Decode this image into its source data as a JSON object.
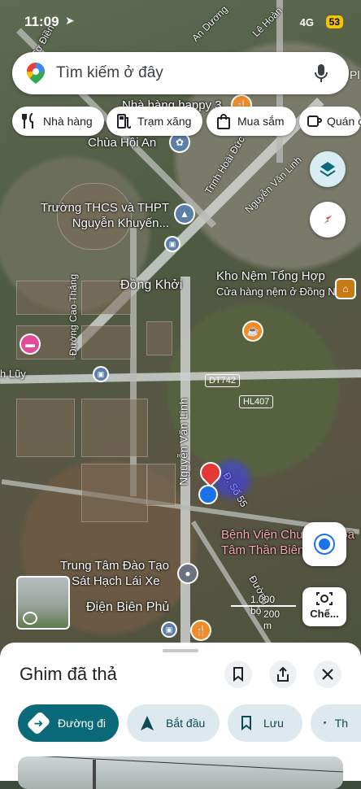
{
  "status_bar": {
    "time": "11:09",
    "network": "4G",
    "battery": "53"
  },
  "search": {
    "placeholder": "Tìm kiếm ở đây",
    "right_partial": "Pl"
  },
  "chips": [
    {
      "label": "Nhà hàng",
      "icon": "fork-knife-icon"
    },
    {
      "label": "Trạm xăng",
      "icon": "gas-station-icon"
    },
    {
      "label": "Mua sắm",
      "icon": "shopping-bag-icon"
    },
    {
      "label": "Quán cà",
      "icon": "coffee-cup-icon"
    }
  ],
  "map": {
    "places": {
      "school": "Trường THCS và THPT Nguyễn Khuyến...",
      "pagoda": "Chùa Hội An",
      "restaurant": "Nhà hàng happy 3",
      "store_name": "Kho Nệm Tổng Hợp",
      "store_sub": "Cửa hàng nệm ở Đồng Nai",
      "hospital_1": "Bệnh Viện Chuyên Khoa",
      "hospital_2": "Tâm Thần Biên Hòa",
      "training_1": "Trung Tâm Đào Tạo",
      "training_2": "& Sát Hạch Lái Xe",
      "dong_khoi": "Đồng Khởi",
      "dien_bien_phu": "Điện Biên Phủ",
      "lay": "h Lũy",
      "phi": "Phi",
      "an_duong": "An Dương",
      "le_hoan": "Lê Hoàn"
    },
    "roads": {
      "nguyen_van_linh_1": "Nguyễn Văn Linh",
      "nguyen_van_linh_2": "Nguyễn Văn Linh",
      "cao_thang": "Đường Cao Thắng",
      "trinh_hoai_duc": "Trịnh Hoài Đức",
      "so_55": "Đ. Số 55",
      "duong": "Đường",
      "co_dien": "Cơ Điền"
    },
    "shields": {
      "dt742": "DT742",
      "hl407": "HL407"
    },
    "scale": {
      "feet": "1.000 bộ",
      "meters": "200 m"
    }
  },
  "camera_button_label": "Chế...",
  "sheet": {
    "title": "Ghim đã thả",
    "actions": {
      "directions": "Đường đi",
      "start": "Bắt đầu",
      "save": "Lưu",
      "partial": "Th"
    }
  },
  "colors": {
    "primary": "#0b6a79",
    "secondary_bg": "#dde9ee",
    "pin_red": "#e53935",
    "location_blue": "#1a73e8"
  }
}
